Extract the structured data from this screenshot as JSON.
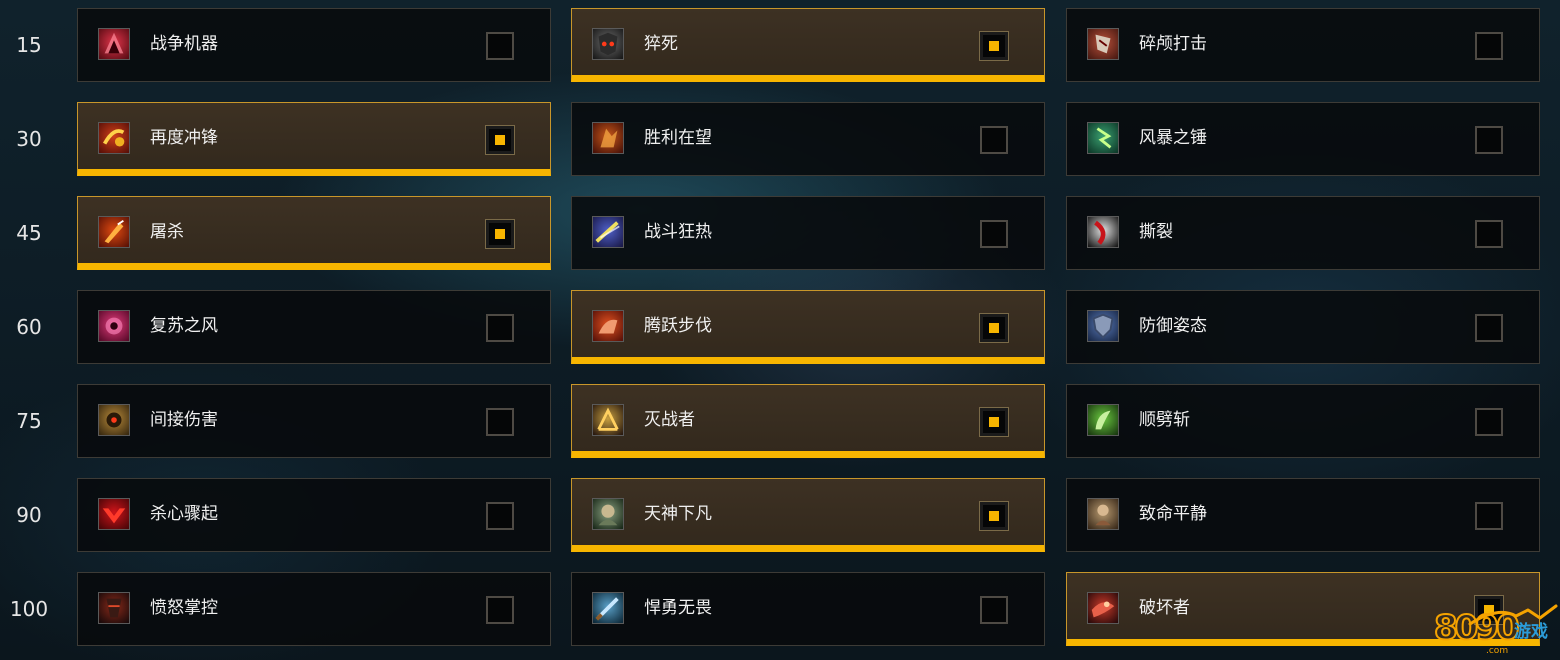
{
  "tiers": [
    {
      "level": "15",
      "talents": [
        {
          "name": "战争机器",
          "icon": "war-machine-icon",
          "selected": false
        },
        {
          "name": "猝死",
          "icon": "sudden-death-icon",
          "selected": true
        },
        {
          "name": "碎颅打击",
          "icon": "skullsplitter-icon",
          "selected": false
        }
      ]
    },
    {
      "level": "30",
      "talents": [
        {
          "name": "再度冲锋",
          "icon": "double-charge-icon",
          "selected": true
        },
        {
          "name": "胜利在望",
          "icon": "impending-victory-icon",
          "selected": false
        },
        {
          "name": "风暴之锤",
          "icon": "storm-bolt-icon",
          "selected": false
        }
      ]
    },
    {
      "level": "45",
      "talents": [
        {
          "name": "屠杀",
          "icon": "massacre-icon",
          "selected": true
        },
        {
          "name": "战斗狂热",
          "icon": "fervor-of-battle-icon",
          "selected": false
        },
        {
          "name": "撕裂",
          "icon": "rend-icon",
          "selected": false
        }
      ]
    },
    {
      "level": "60",
      "talents": [
        {
          "name": "复苏之风",
          "icon": "second-wind-icon",
          "selected": false
        },
        {
          "name": "腾跃步伐",
          "icon": "bounding-stride-icon",
          "selected": true
        },
        {
          "name": "防御姿态",
          "icon": "defensive-stance-icon",
          "selected": false
        }
      ]
    },
    {
      "level": "75",
      "talents": [
        {
          "name": "间接伤害",
          "icon": "collateral-damage-icon",
          "selected": false
        },
        {
          "name": "灭战者",
          "icon": "warbreaker-icon",
          "selected": true
        },
        {
          "name": "顺劈斩",
          "icon": "cleave-icon",
          "selected": false
        }
      ]
    },
    {
      "level": "90",
      "talents": [
        {
          "name": "杀心骤起",
          "icon": "in-for-the-kill-icon",
          "selected": false
        },
        {
          "name": "天神下凡",
          "icon": "avatar-icon",
          "selected": true
        },
        {
          "name": "致命平静",
          "icon": "deadly-calm-icon",
          "selected": false
        }
      ]
    },
    {
      "level": "100",
      "talents": [
        {
          "name": "愤怒掌控",
          "icon": "anger-management-icon",
          "selected": false
        },
        {
          "name": "悍勇无畏",
          "icon": "dreadnaught-icon",
          "selected": false
        },
        {
          "name": "破坏者",
          "icon": "ravager-icon",
          "selected": true
        }
      ]
    }
  ],
  "watermark": {
    "digits": "8090",
    "text": "游戏",
    "domain": ".com"
  },
  "colors": {
    "accent": "#f7b500",
    "selected_bg": "#3d3123",
    "tile_bg": "#080a0c"
  }
}
